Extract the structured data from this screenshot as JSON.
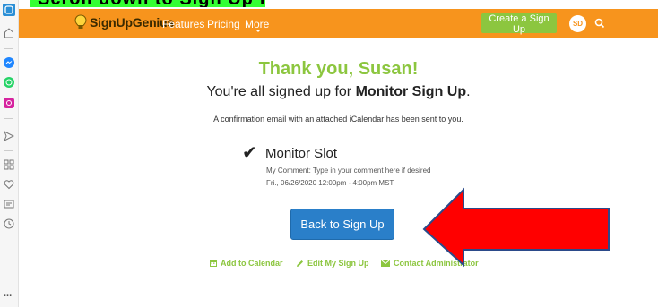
{
  "caption": "Scroll down to Sign Up for a Slot",
  "navbar": {
    "brand": "SignUpGenius",
    "links": [
      "Features",
      "Pricing",
      "More"
    ],
    "create_button": "Create a Sign Up",
    "avatar_initials": "SD",
    "accent_color": "#f7941d"
  },
  "confirmation": {
    "heading": "Thank you, Susan!",
    "signed_up_prefix": "You're all signed up for ",
    "signup_name": "Monitor Sign Up",
    "signed_up_suffix": ".",
    "email_notice": "A confirmation email with an attached iCalendar has been sent to you."
  },
  "slot": {
    "name": "Monitor Slot",
    "comment": "My Comment: Type in your comment here if desired",
    "datetime": "Fri., 06/26/2020 12:00pm - 4:00pm MST"
  },
  "back_button": "Back to Sign Up",
  "actions": {
    "add_calendar": "Add to Calendar",
    "edit_signup": "Edit My Sign Up",
    "contact_admin": "Contact Administrator"
  },
  "sidebar_more": "...",
  "colors": {
    "green": "#8cc63f",
    "blue": "#2a7fc9",
    "arrow_red": "#ff0000"
  }
}
